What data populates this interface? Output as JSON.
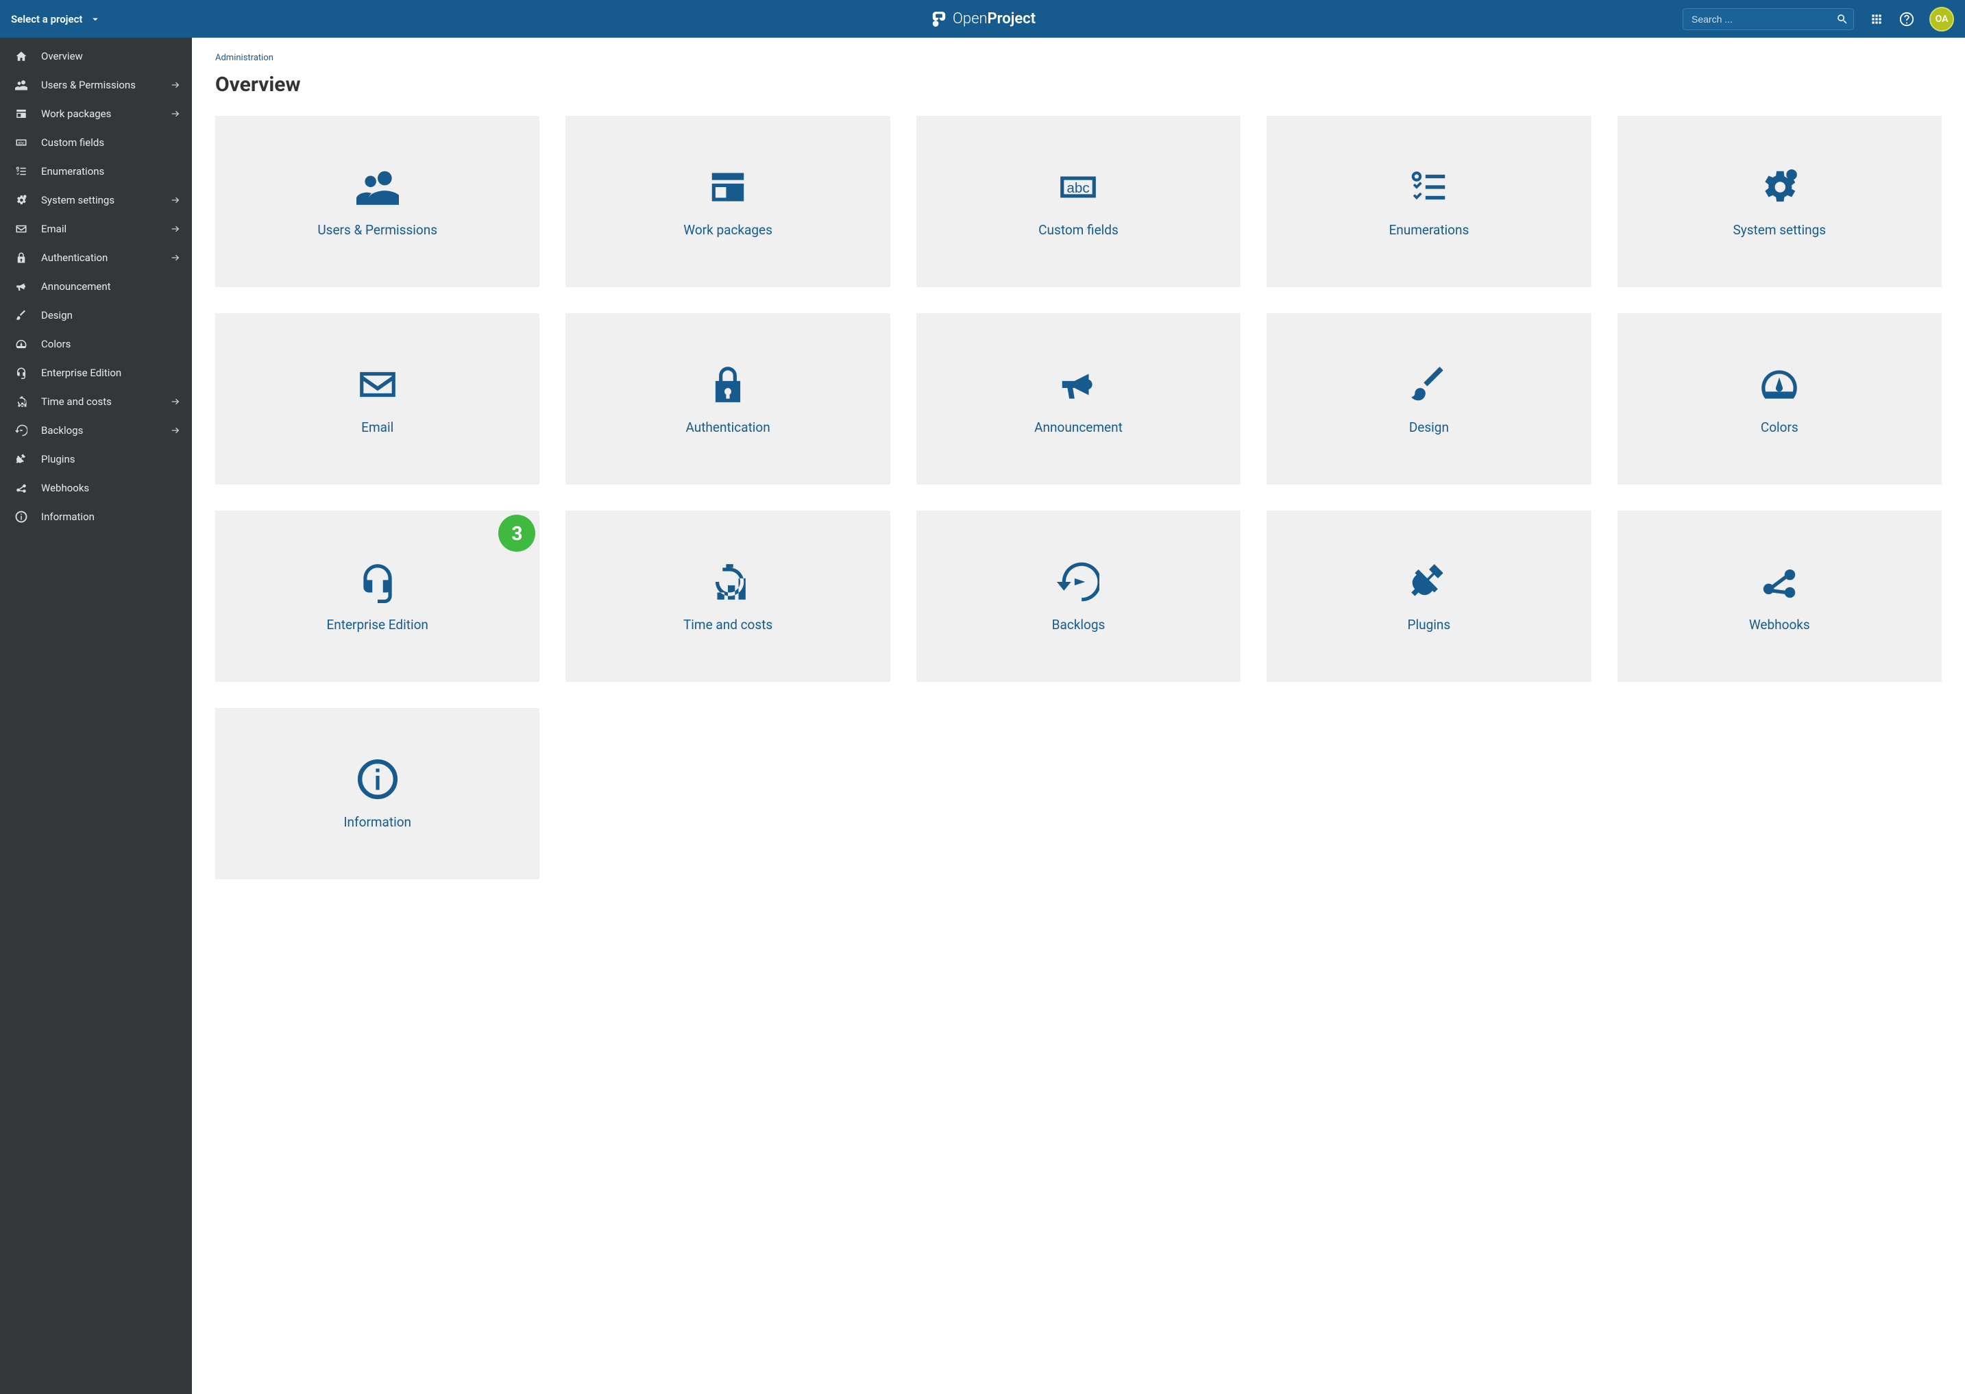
{
  "header": {
    "project_selector": "Select a project",
    "logo_text_light": "Open",
    "logo_text_bold": "Project",
    "search_placeholder": "Search ...",
    "avatar_initials": "OA"
  },
  "sidebar": {
    "items": [
      {
        "label": "Overview",
        "icon": "home",
        "arrow": false
      },
      {
        "label": "Users & Permissions",
        "icon": "users",
        "arrow": true
      },
      {
        "label": "Work packages",
        "icon": "workpackage",
        "arrow": true
      },
      {
        "label": "Custom fields",
        "icon": "customfields",
        "arrow": false
      },
      {
        "label": "Enumerations",
        "icon": "enumerations",
        "arrow": false
      },
      {
        "label": "System settings",
        "icon": "gears",
        "arrow": true
      },
      {
        "label": "Email",
        "icon": "email",
        "arrow": true
      },
      {
        "label": "Authentication",
        "icon": "lock",
        "arrow": true
      },
      {
        "label": "Announcement",
        "icon": "bullhorn",
        "arrow": false
      },
      {
        "label": "Design",
        "icon": "brush",
        "arrow": false
      },
      {
        "label": "Colors",
        "icon": "gauge",
        "arrow": false
      },
      {
        "label": "Enterprise Edition",
        "icon": "headset",
        "arrow": false
      },
      {
        "label": "Time and costs",
        "icon": "timecosts",
        "arrow": true
      },
      {
        "label": "Backlogs",
        "icon": "backlogs",
        "arrow": true
      },
      {
        "label": "Plugins",
        "icon": "plug",
        "arrow": false
      },
      {
        "label": "Webhooks",
        "icon": "webhook",
        "arrow": false
      },
      {
        "label": "Information",
        "icon": "info",
        "arrow": false
      }
    ]
  },
  "main": {
    "breadcrumb": "Administration",
    "title": "Overview",
    "tiles": [
      {
        "label": "Users & Permissions",
        "icon": "users"
      },
      {
        "label": "Work packages",
        "icon": "workpackage"
      },
      {
        "label": "Custom fields",
        "icon": "customfields"
      },
      {
        "label": "Enumerations",
        "icon": "enumerations"
      },
      {
        "label": "System settings",
        "icon": "gears"
      },
      {
        "label": "Email",
        "icon": "email"
      },
      {
        "label": "Authentication",
        "icon": "lock"
      },
      {
        "label": "Announcement",
        "icon": "bullhorn"
      },
      {
        "label": "Design",
        "icon": "brush"
      },
      {
        "label": "Colors",
        "icon": "gauge"
      },
      {
        "label": "Enterprise Edition",
        "icon": "headset",
        "badge": "3"
      },
      {
        "label": "Time and costs",
        "icon": "timecosts"
      },
      {
        "label": "Backlogs",
        "icon": "backlogs"
      },
      {
        "label": "Plugins",
        "icon": "plug"
      },
      {
        "label": "Webhooks",
        "icon": "webhook"
      },
      {
        "label": "Information",
        "icon": "info"
      }
    ]
  }
}
